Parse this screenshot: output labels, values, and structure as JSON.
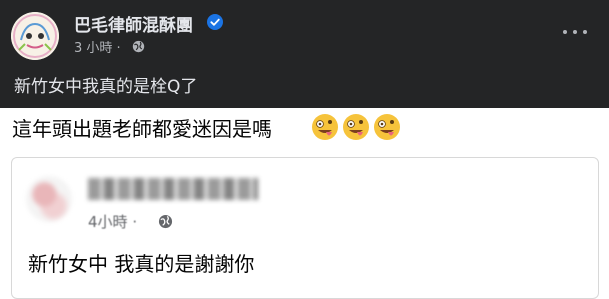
{
  "post": {
    "page_name": "巴毛律師混酥團",
    "time": "3 小時",
    "separator": "·",
    "text": "新竹女中我真的是栓Q了"
  },
  "caption": {
    "text": "這年頭出題老師都愛迷因是嗎",
    "emoji_name": "zany-face-emoji"
  },
  "shared_post": {
    "time": "4小時",
    "separator": "·",
    "text": "新竹女中 我真的是謝謝你"
  },
  "colors": {
    "dark_bg": "#242526",
    "verified": "#1b74e4",
    "emoji_yellow": "#f6c33b"
  }
}
